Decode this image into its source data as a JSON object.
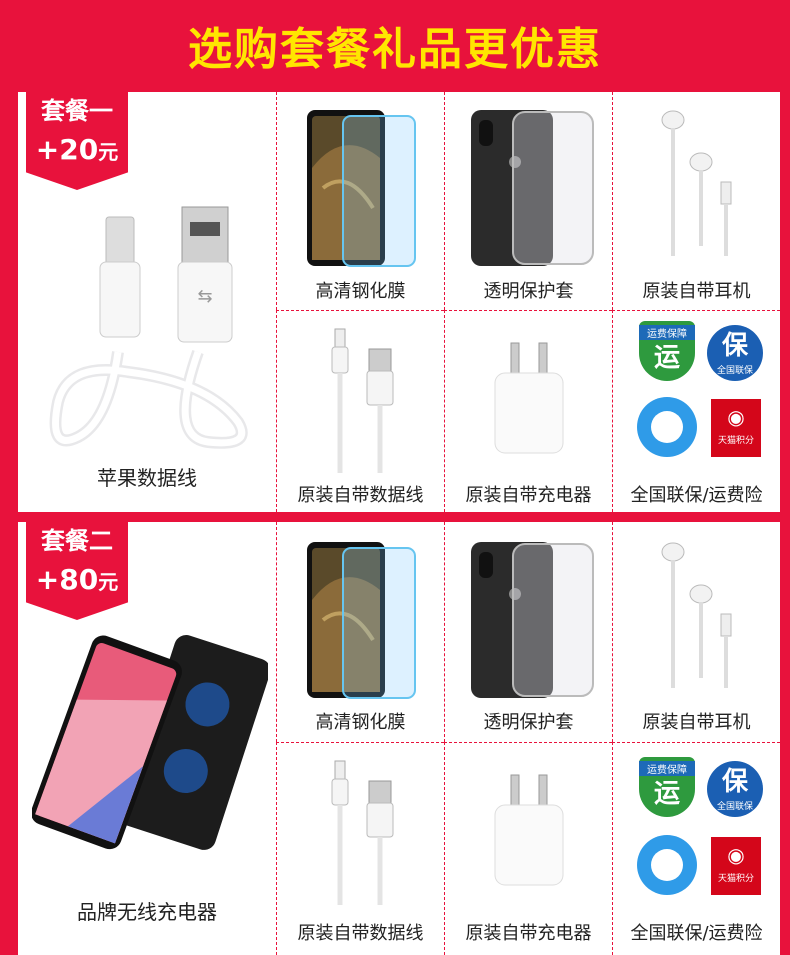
{
  "banner": {
    "title": "选购套餐礼品更优惠"
  },
  "packages": [
    {
      "badge_name": "套餐一",
      "badge_price": "+20",
      "badge_unit": "元",
      "main_item": "苹果数据线",
      "items": [
        "高清钢化膜",
        "透明保护套",
        "原装自带耳机",
        "原装自带数据线",
        "原装自带充电器",
        "全国联保/运费险"
      ]
    },
    {
      "badge_name": "套餐二",
      "badge_price": "+80",
      "badge_unit": "元",
      "main_item": "品牌无线充电器",
      "items": [
        "高清钢化膜",
        "透明保护套",
        "原装自带耳机",
        "原装自带数据线",
        "原装自带充电器",
        "全国联保/运费险"
      ]
    }
  ],
  "icons": {
    "yun": "运",
    "bao": "保",
    "yun_banner": "运费保障",
    "bao_sub": "全国联保",
    "tmall": "天猫积分"
  },
  "colors": {
    "accent": "#e8123c",
    "title": "#ffe600"
  }
}
